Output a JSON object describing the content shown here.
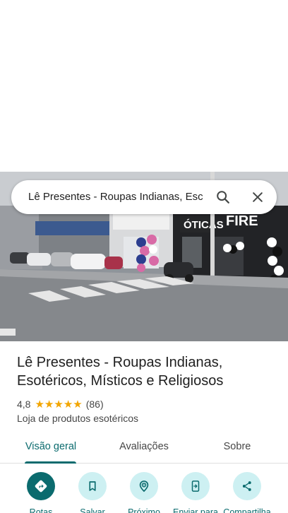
{
  "search": {
    "query": "Lê Presentes - Roupas Indianas, Esc"
  },
  "photo": {
    "signs": [
      "ÓTICAS",
      "FIRE"
    ]
  },
  "place": {
    "title_line1": "Lê Presentes - Roupas Indianas,",
    "title_line2": "Esotéricos, Místicos e Religiosos",
    "rating": "4,8",
    "stars": 5,
    "review_count": "(86)",
    "category": "Loja de produtos esotéricos"
  },
  "tabs": [
    {
      "label": "Visão geral",
      "active": true
    },
    {
      "label": "Avaliações",
      "active": false
    },
    {
      "label": "Sobre",
      "active": false
    }
  ],
  "actions": [
    {
      "label": "Rotas",
      "icon": "directions-icon"
    },
    {
      "label": "Salvar",
      "icon": "bookmark-icon"
    },
    {
      "label": "Próximo",
      "icon": "nearby-icon"
    },
    {
      "label": "Enviar para",
      "icon": "send-to-phone-icon"
    },
    {
      "label": "Compartilha",
      "icon": "share-icon"
    }
  ],
  "colors": {
    "accent": "#0b6b6e",
    "accent_light": "#cdf0f2",
    "star": "#f2a500"
  }
}
